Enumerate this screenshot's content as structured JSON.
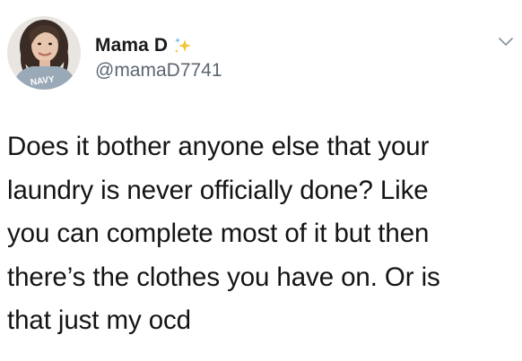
{
  "author": {
    "display_name": "Mama D",
    "handle": "@mamaD7741",
    "avatar_shirt_text": "NAVY"
  },
  "tweet": {
    "text": "Does it bother anyone else that your\nlaundry is never officially done? Like\nyou can complete most of it but then\nthere’s the clothes you have on. Or is\nthat just my ocd"
  },
  "icons": {
    "badge": "sparkles-icon",
    "menu": "chevron-down-icon"
  },
  "colors": {
    "text": "#141414",
    "handle": "#5b6670",
    "sparkle_yellow": "#f4c430",
    "sparkle_blue": "#6fb7e9"
  }
}
